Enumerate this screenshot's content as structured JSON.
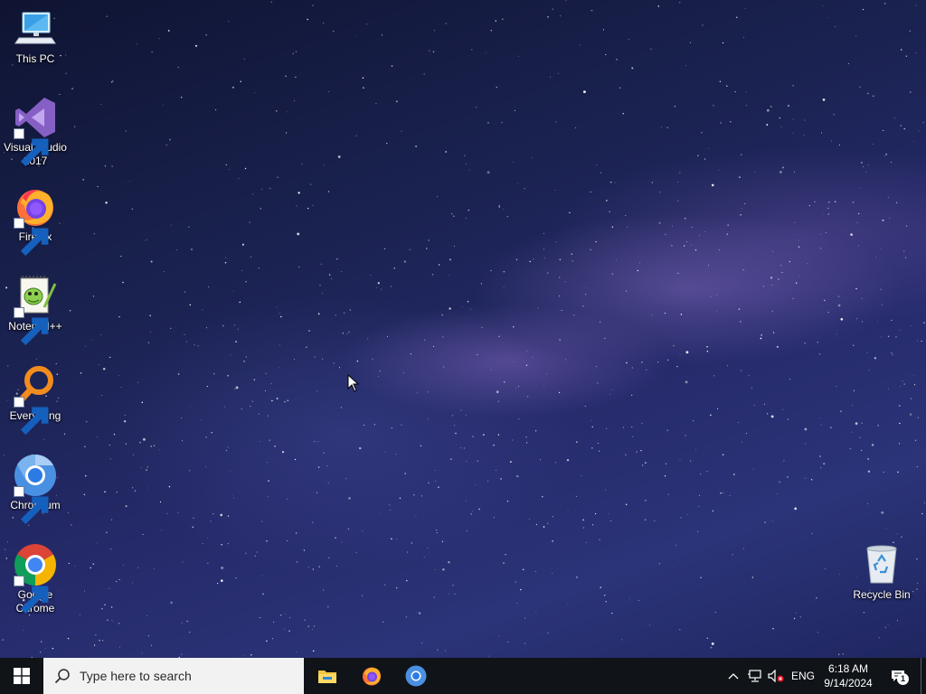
{
  "desktop": {
    "icons": [
      {
        "label": "This PC",
        "icon": "computer-icon"
      },
      {
        "label": "Visual Studio 2017",
        "icon": "visual-studio-icon"
      },
      {
        "label": "Firefox",
        "icon": "firefox-icon"
      },
      {
        "label": "Notepad++",
        "icon": "notepad-plus-plus-icon"
      },
      {
        "label": "Everything",
        "icon": "everything-search-icon"
      },
      {
        "label": "Chromium",
        "icon": "chromium-icon"
      },
      {
        "label": "Google Chrome",
        "icon": "google-chrome-icon"
      },
      {
        "label": "Recycle Bin",
        "icon": "recycle-bin-icon"
      }
    ]
  },
  "taskbar": {
    "start_icon": "windows-logo-icon",
    "search": {
      "placeholder": "Type here to search",
      "icon": "search-icon"
    },
    "pinned_apps": [
      {
        "name": "File Explorer",
        "icon": "file-explorer-icon"
      },
      {
        "name": "Firefox",
        "icon": "firefox-icon"
      },
      {
        "name": "Chromium",
        "icon": "chromium-icon"
      }
    ],
    "tray": {
      "language": "ENG",
      "time": "6:18 AM",
      "date": "9/14/2024",
      "notification_count": "1"
    }
  },
  "colors": {
    "taskbar": "#101418",
    "search_bg": "#f2f2f2",
    "windows_blue": "#ffffff",
    "chrome_red": "#db4437",
    "chrome_green": "#0f9d58",
    "chrome_yellow": "#f4b400",
    "chromium_blue": "#4a90e2",
    "vs_purple": "#865fc5",
    "everything_orange": "#f28c1e"
  }
}
